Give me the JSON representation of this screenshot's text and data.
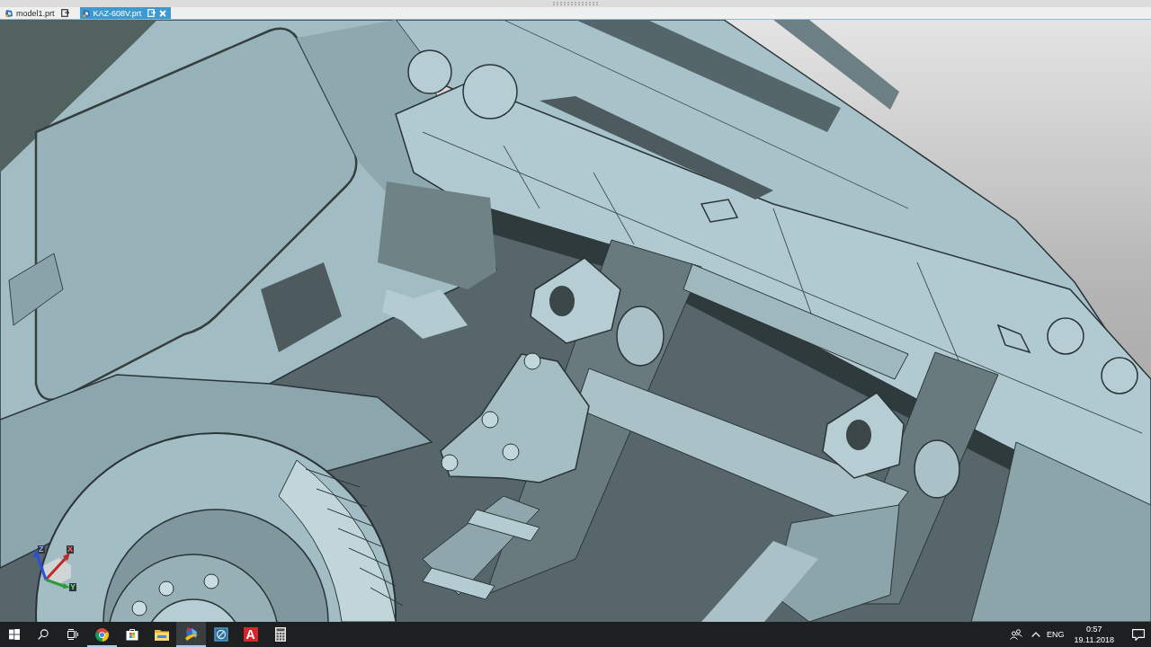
{
  "tabs": [
    {
      "label": "model1.prt",
      "selected": false,
      "closable": false
    },
    {
      "label": "KAZ-608V.prt",
      "selected": true,
      "closable": true
    }
  ],
  "viewport": {
    "triad": {
      "x_label": "X",
      "y_label": "Y",
      "z_label": "Z"
    }
  },
  "taskbar": {
    "buttons": [
      {
        "kind": "start",
        "running": false,
        "selected": false
      },
      {
        "kind": "search",
        "running": false,
        "selected": false
      },
      {
        "kind": "task-view",
        "running": false,
        "selected": false
      },
      {
        "kind": "chrome",
        "running": true,
        "selected": false
      },
      {
        "kind": "store",
        "running": false,
        "selected": false
      },
      {
        "kind": "explorer",
        "running": false,
        "selected": false
      },
      {
        "kind": "cad",
        "running": true,
        "selected": true
      },
      {
        "kind": "circle-app",
        "running": false,
        "selected": false
      },
      {
        "kind": "letter-app",
        "glyph": "A",
        "running": false,
        "selected": false
      },
      {
        "kind": "calculator",
        "running": false,
        "selected": false
      }
    ],
    "tray": {
      "language": "ENG",
      "time": "0:57",
      "date": "19.11.2018"
    }
  }
}
